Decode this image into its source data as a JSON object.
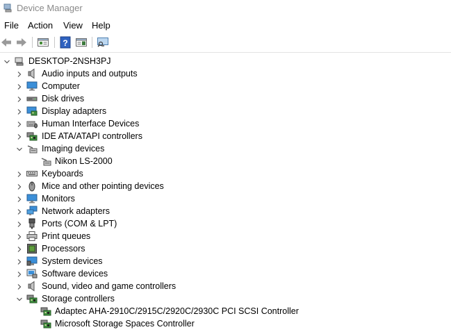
{
  "window": {
    "title": "Device Manager"
  },
  "menu": [
    "File",
    "Action",
    "View",
    "Help"
  ],
  "toolbar": [
    "back-icon",
    "forward-icon",
    "properties-view-icon",
    "help-icon",
    "details-pane-icon",
    "scan-hardware-icon"
  ],
  "tree": {
    "root": "DESKTOP-2NSH3PJ",
    "items": [
      {
        "label": "Audio inputs and outputs",
        "icon": "speaker-icon",
        "state": "collapsed"
      },
      {
        "label": "Computer",
        "icon": "computer-icon",
        "state": "collapsed"
      },
      {
        "label": "Disk drives",
        "icon": "disk-drive-icon",
        "state": "collapsed"
      },
      {
        "label": "Display adapters",
        "icon": "display-adapter-icon",
        "state": "collapsed"
      },
      {
        "label": "Human Interface Devices",
        "icon": "hid-icon",
        "state": "collapsed"
      },
      {
        "label": "IDE ATA/ATAPI controllers",
        "icon": "ide-controller-icon",
        "state": "collapsed"
      },
      {
        "label": "Imaging devices",
        "icon": "scanner-icon",
        "state": "expanded",
        "children": [
          "Nikon LS-2000"
        ]
      },
      {
        "label": "Keyboards",
        "icon": "keyboard-icon",
        "state": "collapsed"
      },
      {
        "label": "Mice and other pointing devices",
        "icon": "mouse-icon",
        "state": "collapsed"
      },
      {
        "label": "Monitors",
        "icon": "monitor-icon",
        "state": "collapsed"
      },
      {
        "label": "Network adapters",
        "icon": "network-adapter-icon",
        "state": "collapsed"
      },
      {
        "label": "Ports (COM & LPT)",
        "icon": "port-icon",
        "state": "collapsed"
      },
      {
        "label": "Print queues",
        "icon": "printer-icon",
        "state": "collapsed"
      },
      {
        "label": "Processors",
        "icon": "processor-icon",
        "state": "collapsed"
      },
      {
        "label": "System devices",
        "icon": "system-device-icon",
        "state": "collapsed"
      },
      {
        "label": "Software devices",
        "icon": "software-device-icon",
        "state": "collapsed"
      },
      {
        "label": "Sound, video and game controllers",
        "icon": "sound-icon",
        "state": "collapsed"
      },
      {
        "label": "Storage controllers",
        "icon": "storage-controller-icon",
        "state": "expanded",
        "children": [
          "Adaptec AHA-2910C/2915C/2920C/2930C PCI SCSI Controller",
          "Microsoft Storage Spaces Controller"
        ]
      }
    ]
  }
}
